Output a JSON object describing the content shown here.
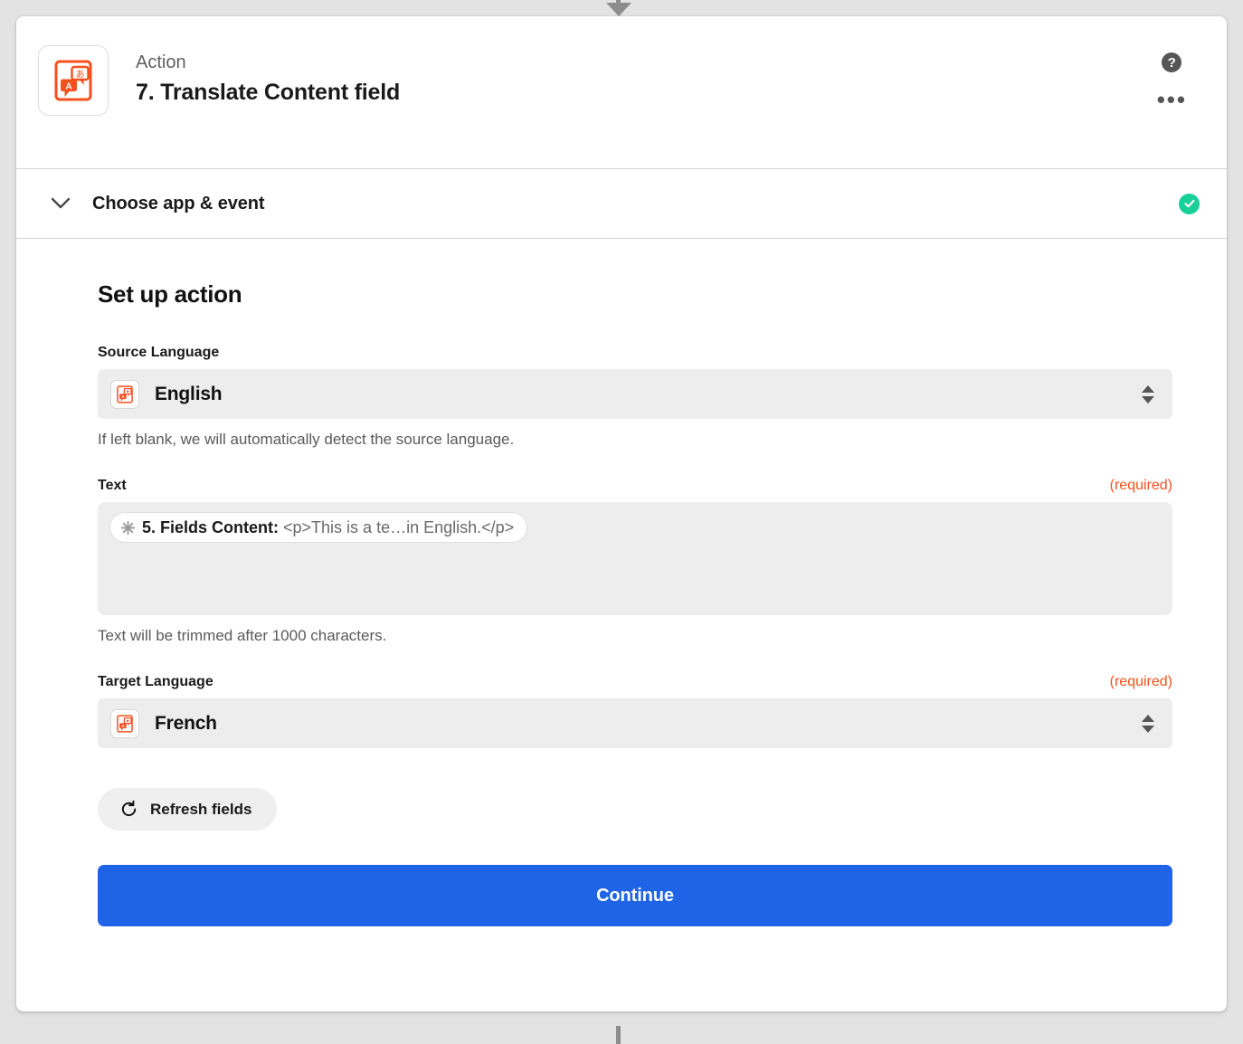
{
  "header": {
    "eyebrow": "Action",
    "title": "7. Translate Content field",
    "app_icon": "translate-app-icon",
    "help_icon": "help-circle-icon",
    "help_glyph": "?",
    "more_icon": "more-options-icon",
    "more_glyph": "•••"
  },
  "sections": {
    "choose_app": {
      "label": "Choose app & event",
      "chevron_icon": "chevron-down-icon",
      "status_icon": "check-circle-icon",
      "status": "complete"
    }
  },
  "setup": {
    "title": "Set up action",
    "source_language": {
      "label": "Source Language",
      "value": "English",
      "icon": "translate-app-icon",
      "helper": "If left blank, we will automatically detect the source language.",
      "stepper_icon": "stepper-updown-icon"
    },
    "text": {
      "label": "Text",
      "required_label": "(required)",
      "token": {
        "icon": "asterisk-icon",
        "label": "5. Fields Content:",
        "value": "<p>This is a te…in English.</p>"
      },
      "helper": "Text will be trimmed after 1000 characters."
    },
    "target_language": {
      "label": "Target Language",
      "required_label": "(required)",
      "value": "French",
      "icon": "translate-app-icon",
      "stepper_icon": "stepper-updown-icon"
    },
    "refresh_button": {
      "label": "Refresh fields",
      "icon": "refresh-icon"
    },
    "continue_button": {
      "label": "Continue"
    }
  },
  "colors": {
    "accent_blue": "#1f64e7",
    "brand_orange": "#f4501e",
    "success_green": "#19cf9a",
    "page_background": "#e3e3e3",
    "field_background": "#ededed"
  }
}
